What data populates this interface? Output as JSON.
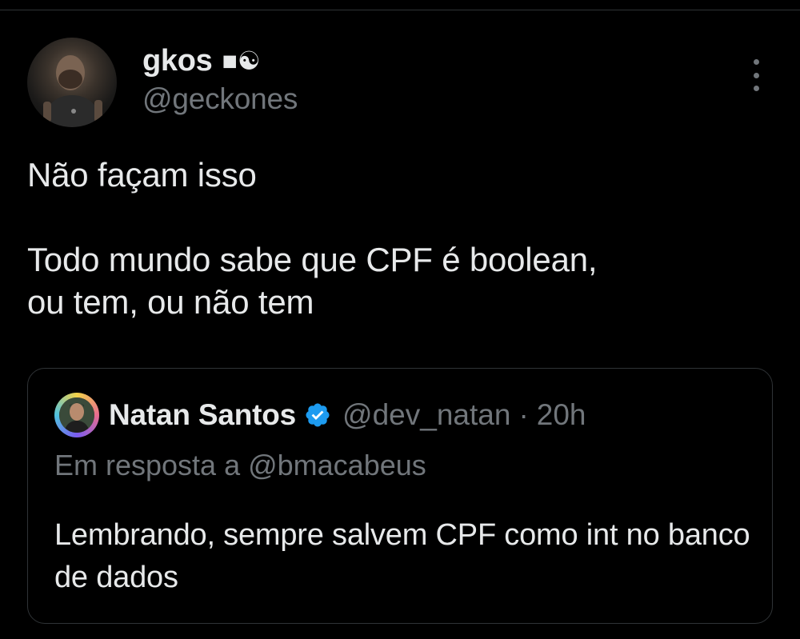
{
  "author": {
    "display_name": "gkos",
    "name_emoji": "■☯",
    "handle": "@geckones"
  },
  "tweet": {
    "line1": "Não façam isso",
    "line2": "Todo mundo sabe que CPF é boolean,",
    "line3": "ou tem, ou não tem"
  },
  "quoted": {
    "display_name": "Natan Santos",
    "handle": "@dev_natan",
    "separator": "·",
    "time": "20h",
    "reply_context": "Em resposta a @bmacabeus",
    "text": "Lembrando, sempre salvem CPF como int no banco de dados"
  },
  "icons": {
    "more": "more-vertical-icon",
    "verified": "verified-badge-icon"
  },
  "colors": {
    "background": "#000000",
    "text_primary": "#e7e9ea",
    "text_secondary": "#71767b",
    "border": "#2f3336",
    "verified": "#1d9bf0"
  }
}
